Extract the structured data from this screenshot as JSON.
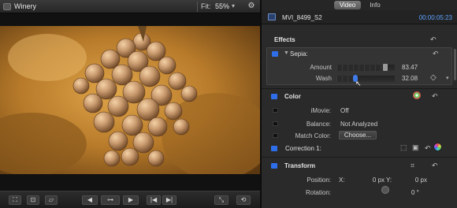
{
  "viewer": {
    "title": "Winery",
    "fit_label": "Fit:",
    "fit_value": "55%",
    "fit_arrow": "▾",
    "toolbar_icons": [
      "crop-frame-icon",
      "crop-icon",
      "distort-icon",
      "play-reverse-icon",
      "jog-wheel-icon",
      "play-icon",
      "previous-edit-icon",
      "next-edit-icon",
      "fullscreen-icon",
      "loop-icon"
    ]
  },
  "inspector": {
    "tabs": [
      {
        "label": "Video",
        "active": true
      },
      {
        "label": "Info",
        "active": false
      }
    ],
    "clip_name": "MVI_8499_S2",
    "timecode": "00:00:05:23",
    "effects": {
      "title": "Effects",
      "sepia": {
        "name": "Sepia:",
        "amount_label": "Amount",
        "amount_value": "83.47",
        "amount": 83.47,
        "wash_label": "Wash",
        "wash_value": "32.08",
        "wash": 32.08
      }
    },
    "color": {
      "title": "Color",
      "imovie_label": "iMovie:",
      "imovie_value": "Off",
      "balance_label": "Balance:",
      "balance_value": "Not Analyzed",
      "match_label": "Match Color:",
      "choose_label": "Choose...",
      "correction_label": "Correction 1:"
    },
    "transform": {
      "title": "Transform",
      "position_label": "Position:",
      "x_label": "X:",
      "x_value": "0 px",
      "y_label": "Y:",
      "y_value": "0 px",
      "rotation_label": "Rotation:",
      "rotation_value": "0 °"
    }
  },
  "colors": {
    "accent_blue": "#2e6ee8",
    "timecode_blue": "#5da2ff"
  }
}
